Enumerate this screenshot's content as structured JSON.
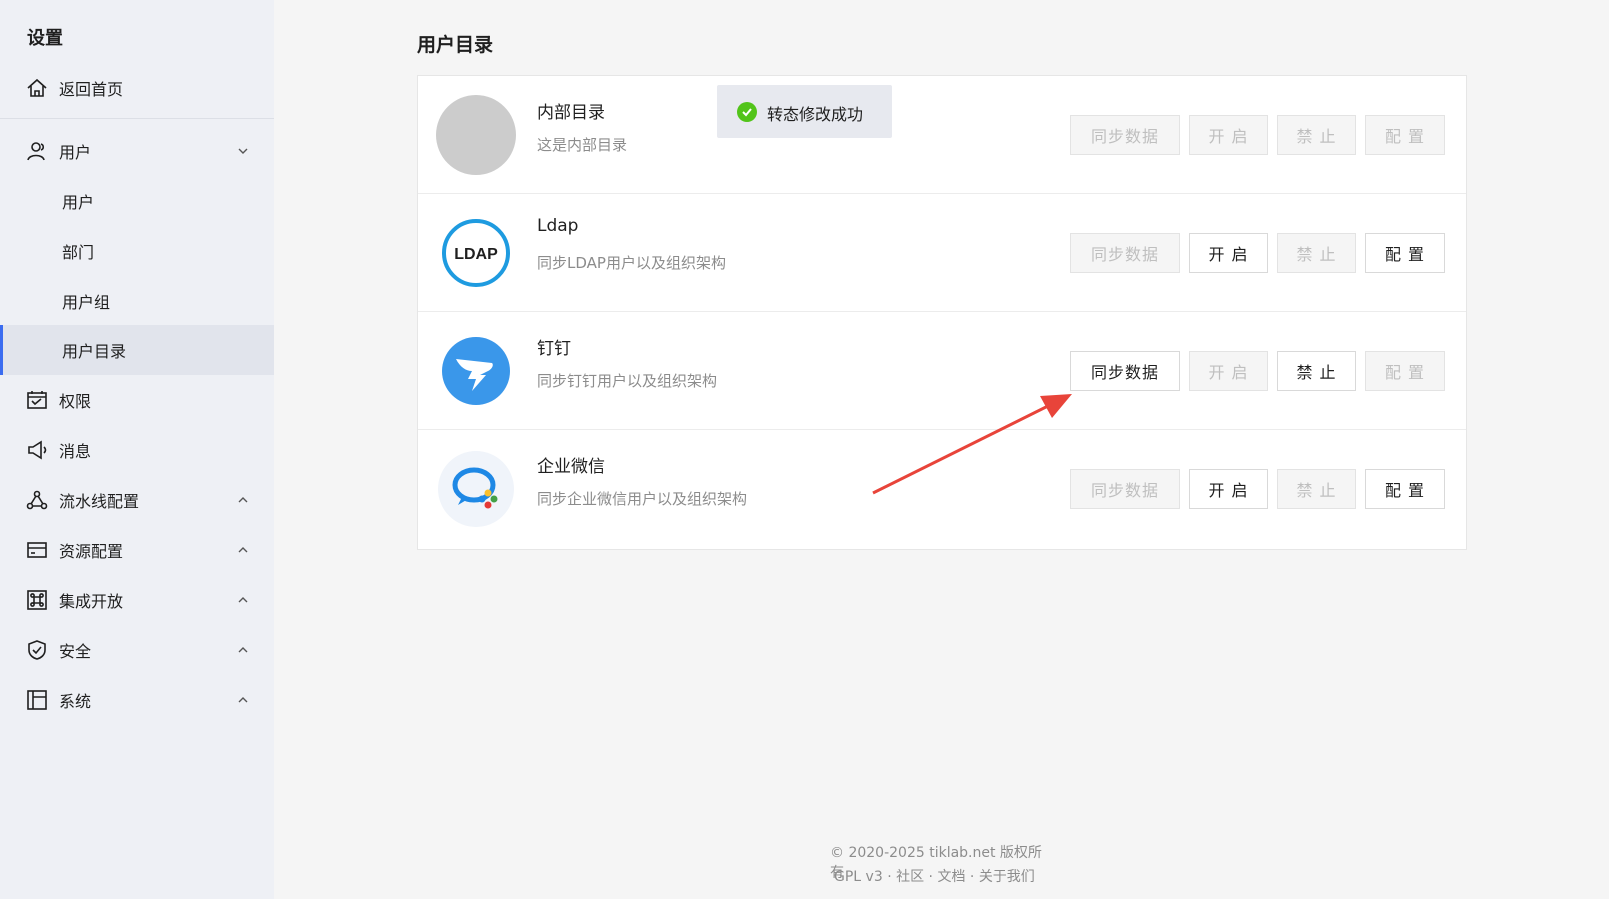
{
  "sidebar": {
    "title": "设置",
    "home": "返回首页",
    "user_group": "用户",
    "sub_items": [
      "用户",
      "部门",
      "用户组",
      "用户目录"
    ],
    "items": [
      "权限",
      "消息",
      "流水线配置",
      "资源配置",
      "集成开放",
      "安全",
      "系统"
    ]
  },
  "main": {
    "title": "用户目录",
    "toast": "转态修改成功",
    "directories": [
      {
        "name": "内部目录",
        "desc": "这是内部目录",
        "logo": "gray-circle",
        "sync": "同步数据",
        "enable": "开 启",
        "disable": "禁 止",
        "config": "配 置",
        "sync_enabled": false,
        "enable_enabled": false,
        "disable_enabled": false,
        "config_enabled": false
      },
      {
        "name": "Ldap",
        "desc": "同步LDAP用户以及组织架构",
        "logo": "ldap-logo",
        "logo_text": "LDAP",
        "sync": "同步数据",
        "enable": "开 启",
        "disable": "禁 止",
        "config": "配 置",
        "sync_enabled": false,
        "enable_enabled": true,
        "disable_enabled": false,
        "config_enabled": true
      },
      {
        "name": "钉钉",
        "desc": "同步钉钉用户以及组织架构",
        "logo": "dingtalk-logo",
        "sync": "同步数据",
        "enable": "开 启",
        "disable": "禁 止",
        "config": "配 置",
        "sync_enabled": true,
        "enable_enabled": false,
        "disable_enabled": true,
        "config_enabled": false
      },
      {
        "name": "企业微信",
        "desc": "同步企业微信用户以及组织架构",
        "logo": "wecom-logo",
        "sync": "同步数据",
        "enable": "开 启",
        "disable": "禁 止",
        "config": "配 置",
        "sync_enabled": false,
        "enable_enabled": true,
        "disable_enabled": false,
        "config_enabled": true
      }
    ]
  },
  "footer": {
    "copyright": "© 2020-2025 tiklab.net 版权所有",
    "license": "GPL v3",
    "community": "社区",
    "docs": "文档",
    "about": "关于我们",
    "sep": "·"
  },
  "colors": {
    "accent": "#3b6cf0",
    "success": "#52c41a",
    "annotation_arrow": "#e8443a"
  }
}
